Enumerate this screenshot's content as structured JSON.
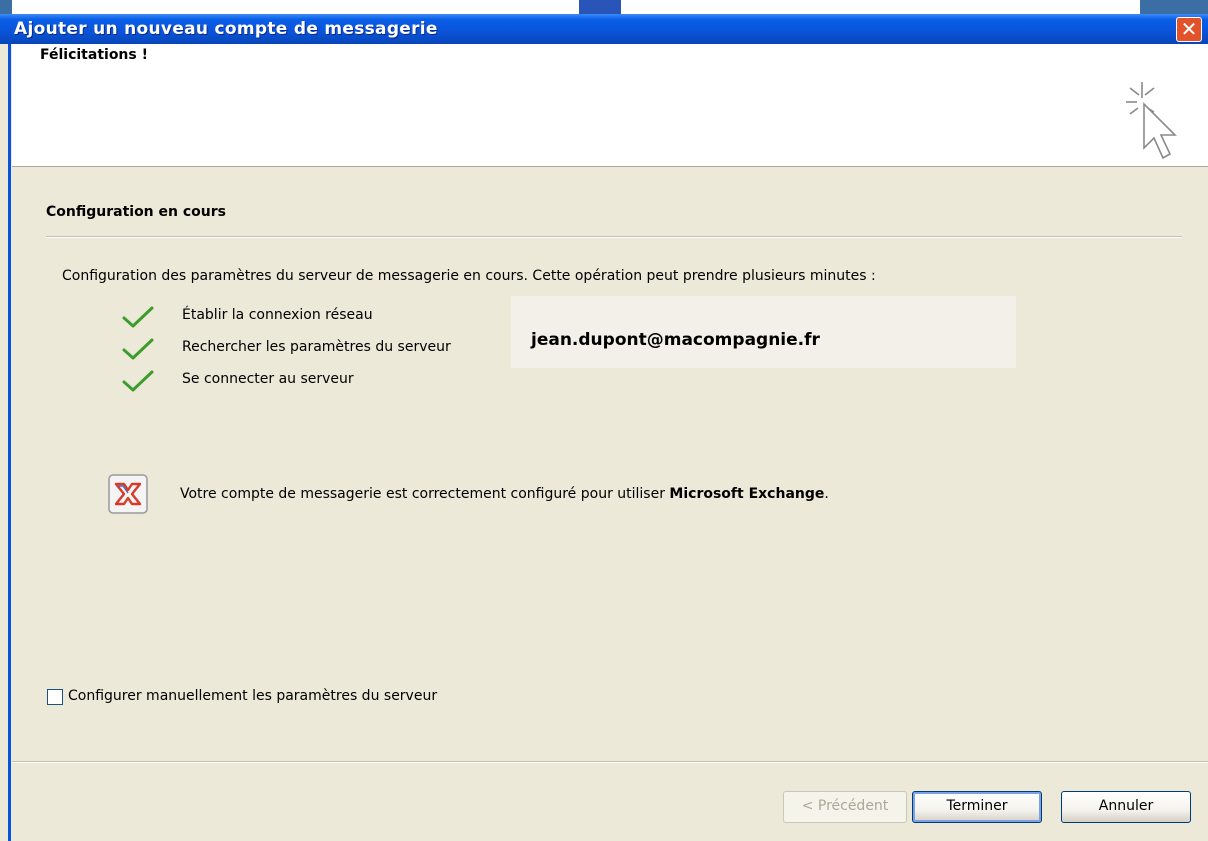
{
  "window": {
    "title": "Ajouter un nouveau compte de messagerie",
    "close_symbol": "✕"
  },
  "header": {
    "title": "Félicitations !",
    "icon": "wizard-cursor-icon"
  },
  "section": {
    "title": "Configuration en cours",
    "intro": "Configuration des paramètres du serveur de messagerie en cours. Cette opération peut prendre plusieurs minutes :"
  },
  "steps": [
    {
      "label": "Établir la connexion réseau",
      "status": "done",
      "icon": "checkmark-icon"
    },
    {
      "label": "Rechercher les paramètres du serveur",
      "status": "done",
      "icon": "checkmark-icon"
    },
    {
      "label": "Se connecter au serveur",
      "status": "done",
      "icon": "checkmark-icon"
    }
  ],
  "account": {
    "email": "jean.dupont@macompagnie.fr"
  },
  "result": {
    "icon": "exchange-icon",
    "text_prefix": "Votre compte de messagerie est correctement configuré pour utiliser ",
    "text_bold": "Microsoft Exchange",
    "text_suffix": "."
  },
  "manual_config": {
    "label": "Configurer manuellement les paramètres du serveur",
    "checked": false
  },
  "buttons": {
    "previous": "< Précédent",
    "finish": "Terminer",
    "cancel": "Annuler"
  },
  "colors": {
    "titlebar": "#0a53d8",
    "dialog_bg": "#ece9d8",
    "check_green": "#3c9d2e",
    "close_red": "#e2532c"
  }
}
